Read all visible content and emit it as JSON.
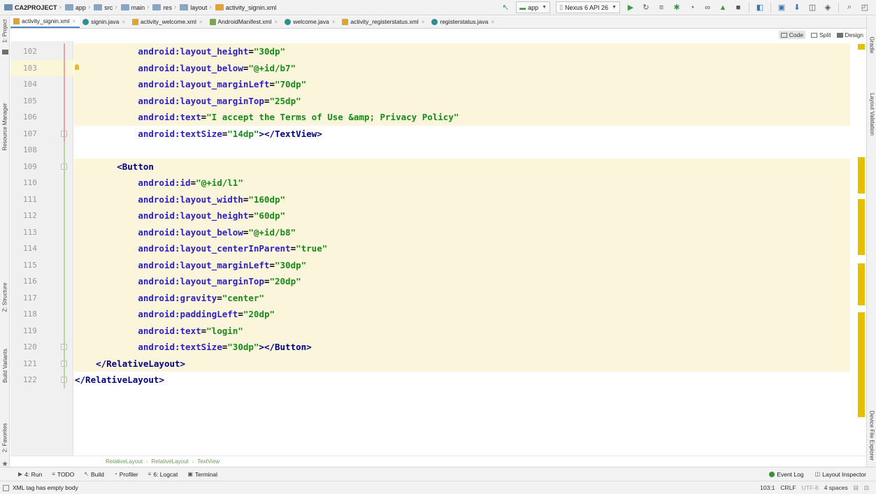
{
  "navbar": {
    "breadcrumbs": [
      "CA2PROJECT",
      "app",
      "src",
      "main",
      "res",
      "layout",
      "activity_signin.xml"
    ],
    "run_config": "app",
    "device": "Nexus 6 API 26"
  },
  "tabs": [
    {
      "label": "activity_signin.xml",
      "type": "xml",
      "active": true
    },
    {
      "label": "signin.java",
      "type": "java",
      "active": false
    },
    {
      "label": "activity_welcome.xml",
      "type": "xml",
      "active": false
    },
    {
      "label": "AndroidManifest.xml",
      "type": "manifest",
      "active": false
    },
    {
      "label": "welcome.java",
      "type": "java",
      "active": false
    },
    {
      "label": "activity_registerstatus.xml",
      "type": "xml",
      "active": false
    },
    {
      "label": "registerstatus.java",
      "type": "java",
      "active": false
    }
  ],
  "modes": {
    "code": "Code",
    "split": "Split",
    "design": "Design"
  },
  "left_tools": [
    "1: Project",
    "Resource Manager",
    "Z: Structure",
    "Build Variants",
    "2: Favorites"
  ],
  "right_tools": [
    "Gradle",
    "Layout Validation",
    "Device File Explorer"
  ],
  "code_lines": [
    {
      "n": "102",
      "text": "            android:layout_height=\"30dp\""
    },
    {
      "n": "103",
      "text": "            android:layout_below=\"@+id/b7\""
    },
    {
      "n": "104",
      "text": "            android:layout_marginLeft=\"70dp\""
    },
    {
      "n": "105",
      "text": "            android:layout_marginTop=\"25dp\""
    },
    {
      "n": "106",
      "text": "            android:text=\"I accept the Terms of Use &amp; Privacy Policy\""
    },
    {
      "n": "107",
      "text": "            android:textSize=\"14dp\"></TextView>"
    },
    {
      "n": "108",
      "text": ""
    },
    {
      "n": "109",
      "text": "        <Button"
    },
    {
      "n": "110",
      "text": "            android:id=\"@+id/l1\""
    },
    {
      "n": "111",
      "text": "            android:layout_width=\"160dp\""
    },
    {
      "n": "112",
      "text": "            android:layout_height=\"60dp\""
    },
    {
      "n": "113",
      "text": "            android:layout_below=\"@+id/b8\""
    },
    {
      "n": "114",
      "text": "            android:layout_centerInParent=\"true\""
    },
    {
      "n": "115",
      "text": "            android:layout_marginLeft=\"30dp\""
    },
    {
      "n": "116",
      "text": "            android:layout_marginTop=\"20dp\""
    },
    {
      "n": "117",
      "text": "            android:gravity=\"center\""
    },
    {
      "n": "118",
      "text": "            android:paddingLeft=\"20dp\""
    },
    {
      "n": "119",
      "text": "            android:text=\"login\""
    },
    {
      "n": "120",
      "text": "            android:textSize=\"30dp\"></Button>"
    },
    {
      "n": "121",
      "text": "    </RelativeLayout>"
    },
    {
      "n": "122",
      "text": "</RelativeLayout>"
    }
  ],
  "editor_breadcrumbs": [
    "RelativeLayout",
    "RelativeLayout",
    "TextView"
  ],
  "bottom_tools": [
    {
      "label": "4: Run",
      "icon": "run-icon"
    },
    {
      "label": "TODO",
      "icon": "todo-icon"
    },
    {
      "label": "Build",
      "icon": "build-icon"
    },
    {
      "label": "Profiler",
      "icon": "profiler-icon"
    },
    {
      "label": "6: Logcat",
      "icon": "logcat-icon"
    },
    {
      "label": "Terminal",
      "icon": "terminal-icon"
    }
  ],
  "bottom_right": {
    "event_log": "Event Log",
    "layout_inspector": "Layout Inspector"
  },
  "status": {
    "message": "XML tag has empty body",
    "position": "103:1",
    "line_sep": "CRLF",
    "encoding": "UTF-8",
    "indent": "4 spaces"
  },
  "colors": {
    "tag": "#000080",
    "attr": "#2a21c4",
    "value": "#178a17",
    "highlight": "#fbf5dc",
    "marker": "#e6c000"
  }
}
